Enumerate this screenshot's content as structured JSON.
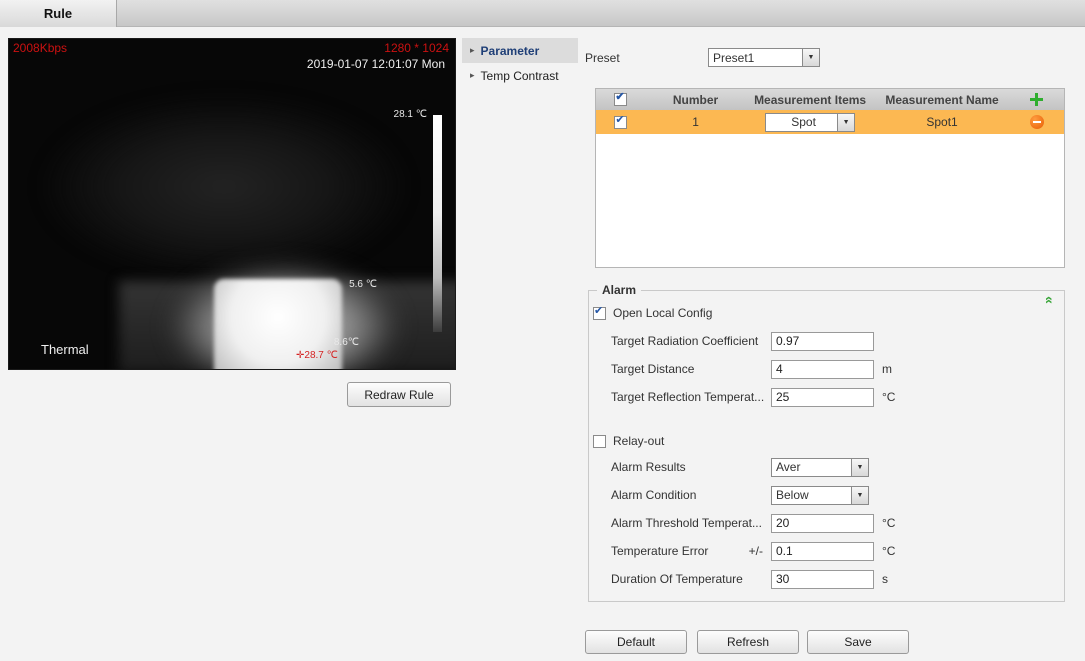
{
  "tab": {
    "label": "Rule"
  },
  "icons": {
    "menu_arrow": "▸",
    "dropdown_arrow": "▼",
    "check": "✔",
    "collapse": "«"
  },
  "video": {
    "bitrate": "2008Kbps",
    "resolution": "1280 * 1024",
    "timestamp": "2019-01-07 12:01:07 Mon",
    "scale_max": "28.1 ℃",
    "scale_mid": "5.6 ℃",
    "scale_min": "8.6℃",
    "spot_temp": "✛28.7 ℃",
    "label": "Thermal"
  },
  "redraw_button": "Redraw Rule",
  "menu": {
    "items": [
      {
        "label": "Parameter",
        "active": true
      },
      {
        "label": "Temp Contrast",
        "active": false
      }
    ]
  },
  "preset": {
    "label": "Preset",
    "value": "Preset1"
  },
  "measurement_table": {
    "headers": {
      "number": "Number",
      "items": "Measurement Items",
      "name": "Measurement Name"
    },
    "row": {
      "number": "1",
      "item": "Spot",
      "name": "Spot1"
    }
  },
  "alarm": {
    "title": "Alarm",
    "open_local_config": "Open Local Config",
    "target_radiation": {
      "label": "Target Radiation Coefficient",
      "value": "0.97"
    },
    "target_distance": {
      "label": "Target Distance",
      "value": "4",
      "unit": "m"
    },
    "target_reflection": {
      "label": "Target Reflection Temperat...",
      "value": "25",
      "unit": "°C"
    },
    "relay_out": "Relay-out",
    "alarm_results": {
      "label": "Alarm Results",
      "value": "Aver"
    },
    "alarm_condition": {
      "label": "Alarm Condition",
      "value": "Below"
    },
    "alarm_threshold": {
      "label": "Alarm Threshold Temperat...",
      "value": "20",
      "unit": "°C"
    },
    "temperature_error": {
      "label": "Temperature Error",
      "prefix": "+/-",
      "value": "0.1",
      "unit": "°C"
    },
    "duration": {
      "label": "Duration Of Temperature",
      "value": "30",
      "unit": "s"
    }
  },
  "footer": {
    "default": "Default",
    "refresh": "Refresh",
    "save": "Save"
  },
  "colors": {
    "row_highlight": "#fcb852",
    "accent_green": "#2fae2f",
    "accent_orange": "#e85d04",
    "overlay_red": "#cc1111"
  }
}
